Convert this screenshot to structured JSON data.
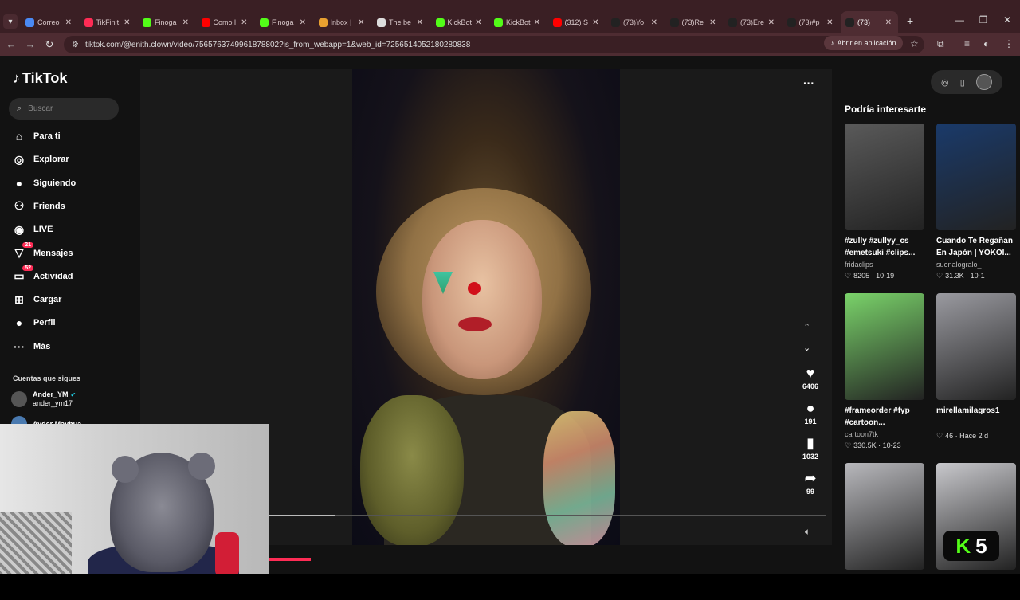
{
  "browser": {
    "tabs": [
      {
        "label": "Correo",
        "color": "#4a8af4"
      },
      {
        "label": "TikFinit",
        "color": "#fe2c55"
      },
      {
        "label": "Finoga",
        "color": "#53fc18"
      },
      {
        "label": "Como l",
        "color": "#ff0000"
      },
      {
        "label": "Finoga",
        "color": "#53fc18"
      },
      {
        "label": "Inbox |",
        "color": "#e8a030"
      },
      {
        "label": "The be",
        "color": "#dddddd"
      },
      {
        "label": "KickBot",
        "color": "#53fc18"
      },
      {
        "label": "KickBot",
        "color": "#53fc18"
      },
      {
        "label": "(312) S",
        "color": "#ff0000"
      },
      {
        "label": "(73)Yo",
        "color": "#222222"
      },
      {
        "label": "(73)Re",
        "color": "#222222"
      },
      {
        "label": "(73)Ere",
        "color": "#222222"
      },
      {
        "label": "(73)#p",
        "color": "#222222"
      },
      {
        "label": "(73)",
        "color": "#222222"
      }
    ],
    "url": "tiktok.com/@enith.clown/video/7565763749961878802?is_from_webapp=1&web_id=7256514052180280838",
    "open_in_app": "Abrir en aplicación"
  },
  "sidebar": {
    "logo": "TikTok",
    "search_placeholder": "Buscar",
    "items": [
      {
        "label": "Para ti",
        "icon": "home-icon",
        "glyph": "⌂"
      },
      {
        "label": "Explorar",
        "icon": "compass-icon",
        "glyph": "◎"
      },
      {
        "label": "Siguiendo",
        "icon": "following-avatar-icon",
        "glyph": "●"
      },
      {
        "label": "Friends",
        "icon": "friends-icon",
        "glyph": "⚇"
      },
      {
        "label": "LIVE",
        "icon": "live-icon",
        "glyph": "◉"
      },
      {
        "label": "Mensajes",
        "icon": "messages-icon",
        "glyph": "▽",
        "badge": "21"
      },
      {
        "label": "Actividad",
        "icon": "activity-icon",
        "glyph": "▭",
        "badge": "52"
      },
      {
        "label": "Cargar",
        "icon": "upload-icon",
        "glyph": "⊞"
      },
      {
        "label": "Perfil",
        "icon": "profile-avatar-icon",
        "glyph": "●"
      },
      {
        "label": "Más",
        "icon": "more-icon",
        "glyph": "···"
      }
    ],
    "following_title": "Cuentas que sigues",
    "accounts": [
      {
        "name": "Ander_YM",
        "handle": "ander_ym17",
        "verified": true
      },
      {
        "name": "Ayder Mayhua",
        "handle": "",
        "verified": false
      }
    ]
  },
  "player": {
    "actions": [
      {
        "icon": "heart-icon",
        "glyph": "♥",
        "count": "6406"
      },
      {
        "icon": "comment-icon",
        "glyph": "●",
        "count": "191"
      },
      {
        "icon": "bookmark-icon",
        "glyph": "▮",
        "count": "1032"
      },
      {
        "icon": "share-icon",
        "glyph": "➦",
        "count": "99"
      }
    ],
    "progress": 0.12
  },
  "recommendations": {
    "title": "Podría interesarte",
    "cards": [
      {
        "desc": "#zully #zullyy_cs #emetsuki #clips...",
        "author": "fridaclips",
        "likes": "8205",
        "date": "10-19",
        "color": "#5a5a5a"
      },
      {
        "desc": "Cuando Te Regañan En Japón | YOKOI...",
        "author": "suenalogralo_",
        "likes": "31.3K",
        "date": "10-1",
        "color": "#1a3a6a"
      },
      {
        "desc": "#frameorder #fyp #cartoon...",
        "author": "cartoon7tk",
        "likes": "330.5K",
        "date": "10-23",
        "color": "#7ad36a"
      },
      {
        "desc": "mirellamilagros1",
        "author": "",
        "likes": "46",
        "date": "Hace 2 d",
        "color": "#9a9aa0"
      },
      {
        "desc": "",
        "author": "",
        "likes": "",
        "date": "",
        "color": "#b8b8bc"
      },
      {
        "desc": "",
        "author": "",
        "likes": "",
        "date": "",
        "color": "#c8c8cc"
      }
    ]
  },
  "overlay": {
    "kick_letter": "K",
    "number": "5"
  }
}
